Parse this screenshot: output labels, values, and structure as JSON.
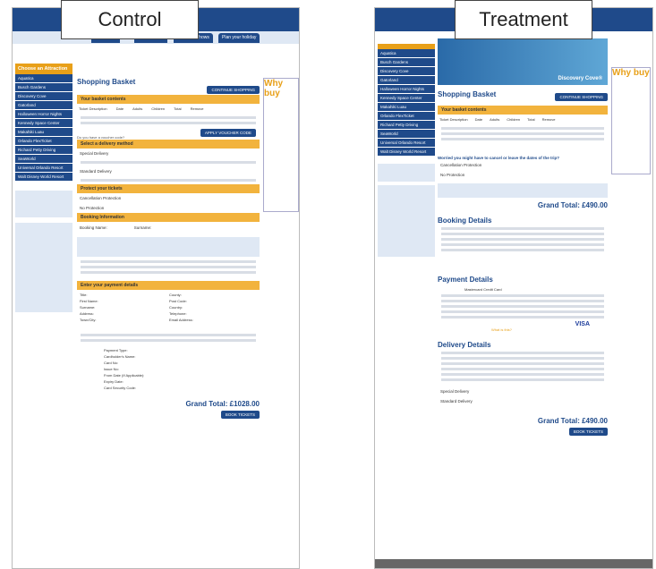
{
  "labels": {
    "control": "Control",
    "treatment": "Treatment"
  },
  "control": {
    "nav_tabs": [
      "Attractions",
      "Trips & Tours",
      "Dinner & Shows",
      "Plan your holiday"
    ],
    "side_heading": "Choose an Attraction",
    "side_items": [
      "Aquatica",
      "Busch Gardens",
      "Discovery Cove",
      "Gatorland",
      "Halloween Horror Nights",
      "Kennedy Space Center",
      "Makahiki Luau",
      "Orlando FlexTicket",
      "Richard Petty Driving",
      "SeaWorld",
      "Universal Orlando Resort",
      "Walt Disney World Resort"
    ],
    "page_title": "Shopping Basket",
    "continue": "CONTINUE SHOPPING",
    "sections": [
      "Your basket contents",
      "Select a delivery method",
      "Protect your tickets",
      "Booking Information",
      "Enter your payment details"
    ],
    "table_headers": [
      "Ticket Description",
      "Date",
      "Adults",
      "Children",
      "Total",
      "Remove"
    ],
    "voucher": "APPLY VOUCHER CODE",
    "voucher_prompt": "Do you have a voucher code?",
    "delivery": [
      "Special Delivery",
      "Standard Delivery"
    ],
    "protection": [
      "Cancellation Protection",
      "No Protection"
    ],
    "booking_name": "Booking Name:",
    "surname": "Surname:",
    "payment_fields": [
      "Title:",
      "First Name:",
      "Surname:",
      "Address:",
      "Town/City:",
      "County:",
      "Post Code:",
      "Country:",
      "Telephone:",
      "Email Address:"
    ],
    "card_fields": [
      "Payment Type:",
      "Cardholder's Name:",
      "Card No:",
      "Issue No:",
      "From Date (If Applicable):",
      "Expiry Date:",
      "Card Security Code:"
    ],
    "payment_type_value": "Mastercard Credit Card",
    "whats_this": "What is this?",
    "grand_total": "Grand Total: £1028.00",
    "book": "BOOK TICKETS",
    "why": "Why buy"
  },
  "treatment": {
    "hero_caption": "Discovery Cove®",
    "side_heading": "",
    "side_items": [
      "Aquatica",
      "Busch Gardens",
      "Discovery Cove",
      "Gatorland",
      "Halloween Horror Nights",
      "Kennedy Space Center",
      "Makahiki Luau",
      "Orlando FlexTicket",
      "Richard Petty Driving",
      "SeaWorld",
      "Universal Orlando Resort",
      "Walt Disney World Resort"
    ],
    "page_title": "Shopping Basket",
    "continue": "CONTINUE SHOPPING",
    "section": "Your basket contents",
    "table_headers": [
      "Ticket Description",
      "Date",
      "Adults",
      "Children",
      "Total",
      "Remove"
    ],
    "worried": "Worried you might have to cancel or leave the dates of the trip?",
    "protection": [
      "Cancellation Protection",
      "No Protection"
    ],
    "grand_total": "Grand Total: £490.00",
    "booking_details": "Booking Details",
    "payment_details": "Payment Details",
    "delivery_details": "Delivery Details",
    "delivery": [
      "Special Delivery",
      "Standard Delivery"
    ],
    "payment_type_value": "Mastercard Credit Card",
    "whats_this": "What is this?",
    "book": "BOOK TICKETS",
    "why": "Why buy"
  }
}
